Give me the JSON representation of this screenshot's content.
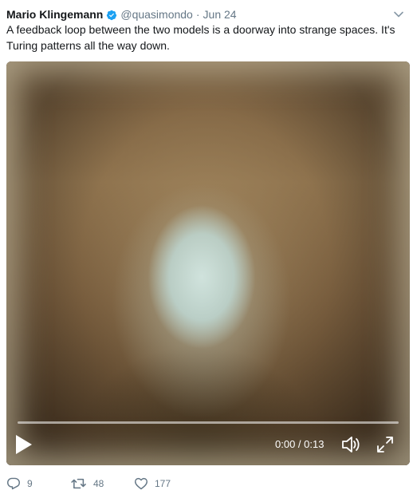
{
  "tweet": {
    "author": {
      "display_name": "Mario Klingemann",
      "handle": "@quasimondo",
      "verified": true
    },
    "separator": "·",
    "date": "Jun 24",
    "text": "A feedback loop between the two models is a doorway into strange spaces. It's Turing patterns all the way down."
  },
  "video": {
    "time": "0:00 / 0:13",
    "progress_fraction": 0
  },
  "actions": {
    "reply_count": "9",
    "retweet_count": "48",
    "like_count": "177"
  },
  "colors": {
    "text": "#14171a",
    "secondary": "#657786",
    "verified": "#1da1f2"
  },
  "icons": {
    "verified": "verified-badge-icon",
    "caret": "chevron-down-icon",
    "play": "play-icon",
    "volume": "volume-muted-icon",
    "fullscreen": "fullscreen-icon",
    "reply": "reply-icon",
    "retweet": "retweet-icon",
    "like": "heart-icon"
  }
}
